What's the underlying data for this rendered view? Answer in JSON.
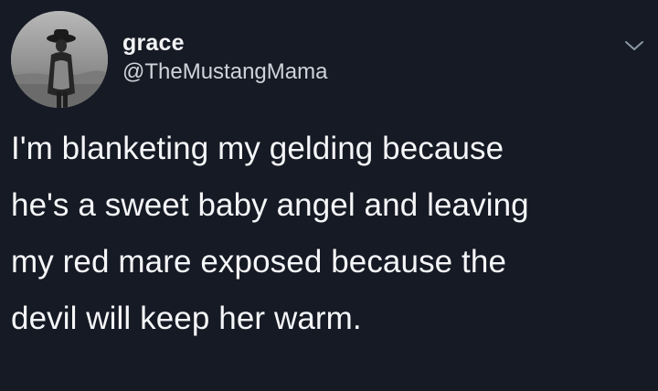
{
  "user": {
    "display_name": "grace",
    "handle": "@TheMustangMama",
    "avatar_icon": "profile-photo"
  },
  "menu": {
    "icon": "chevron-down-icon"
  },
  "tweet": {
    "text": "I'm blanketing my gelding because\nhe's a sweet baby angel and leaving\nmy red mare exposed because the\ndevil will keep her warm."
  },
  "colors": {
    "background": "#161a25",
    "text": "#f5f6f8",
    "handle": "#cfd4da"
  }
}
